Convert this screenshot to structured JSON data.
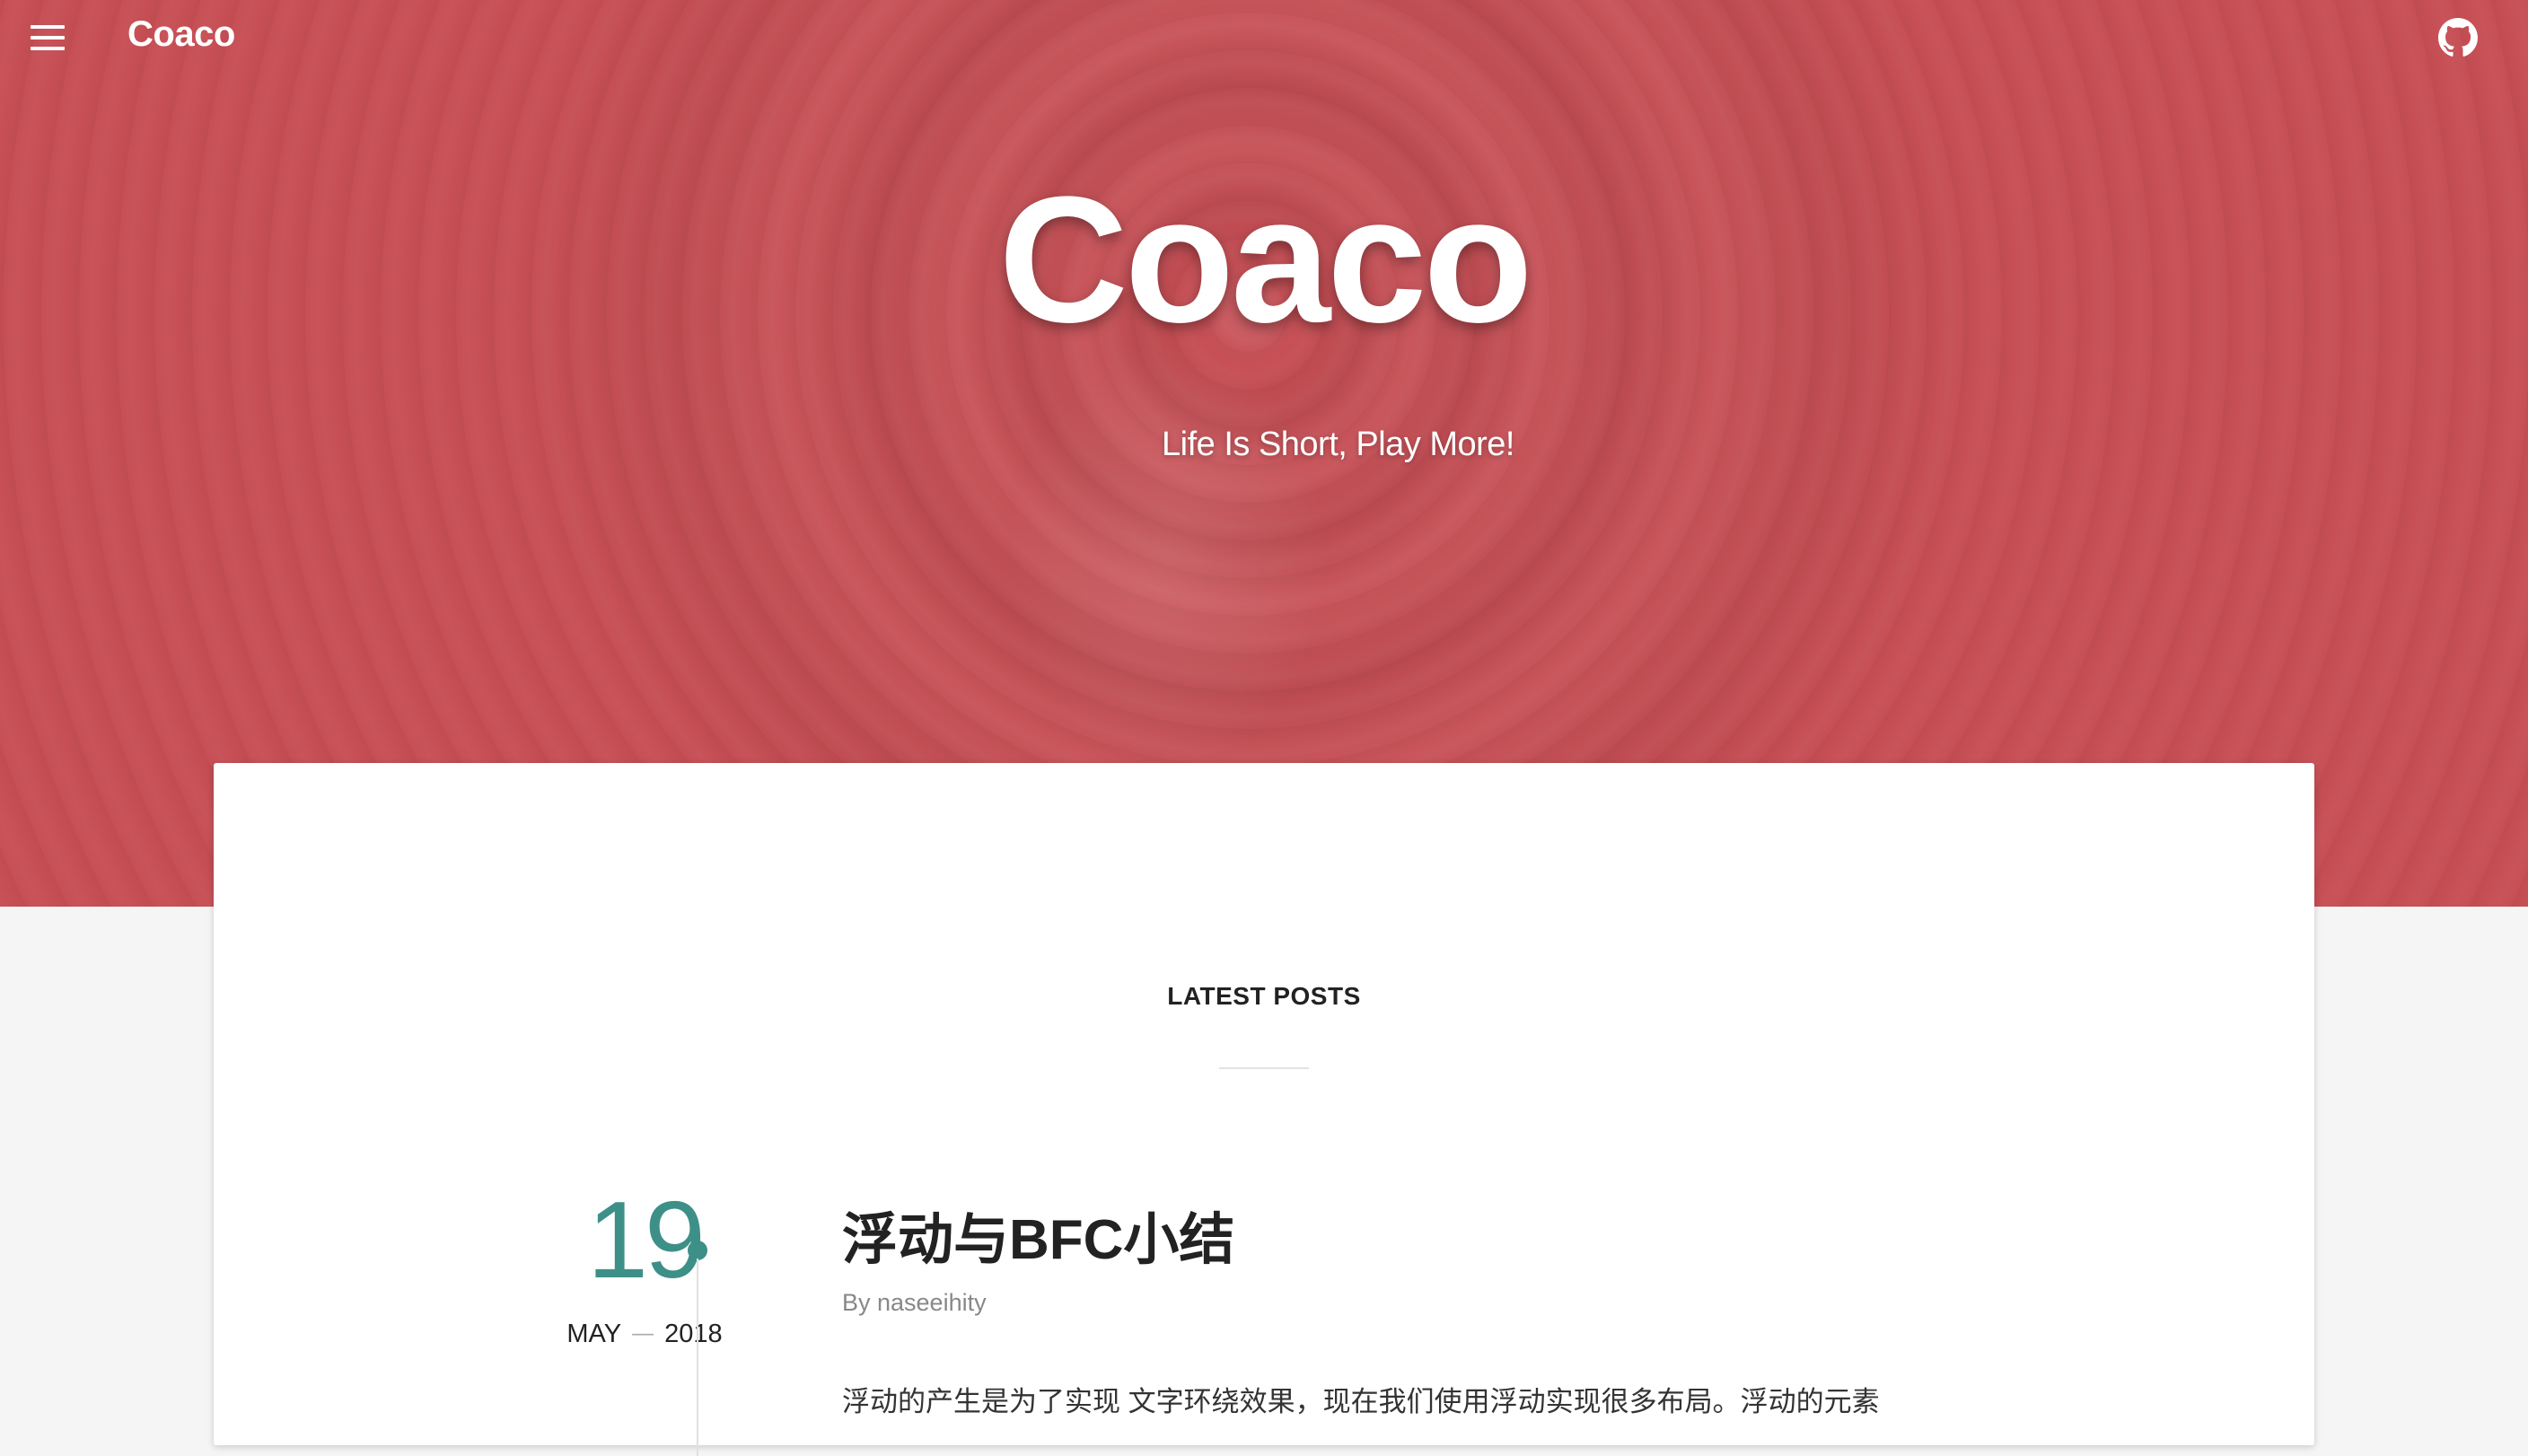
{
  "topbar": {
    "brand": "Coaco",
    "menu_icon": "hamburger-menu-icon",
    "github_icon": "github-icon"
  },
  "hero": {
    "title": "Coaco",
    "subtitle": "Life Is Short, Play More!",
    "background_color": "#c64f55"
  },
  "main": {
    "section_heading": "LATEST POSTS",
    "posts": [
      {
        "day": "19",
        "month": "MAY",
        "separator": "—",
        "year": "2018",
        "title": "浮动与BFC小结",
        "author": "By naseeihity",
        "excerpt": "浮动的产生是为了实现 文字环绕效果，现在我们使用浮动实现很多布局。浮动的元素"
      }
    ]
  },
  "colors": {
    "accent": "#3d9088",
    "hero": "#c64f55",
    "page_background": "#f5f5f5"
  }
}
